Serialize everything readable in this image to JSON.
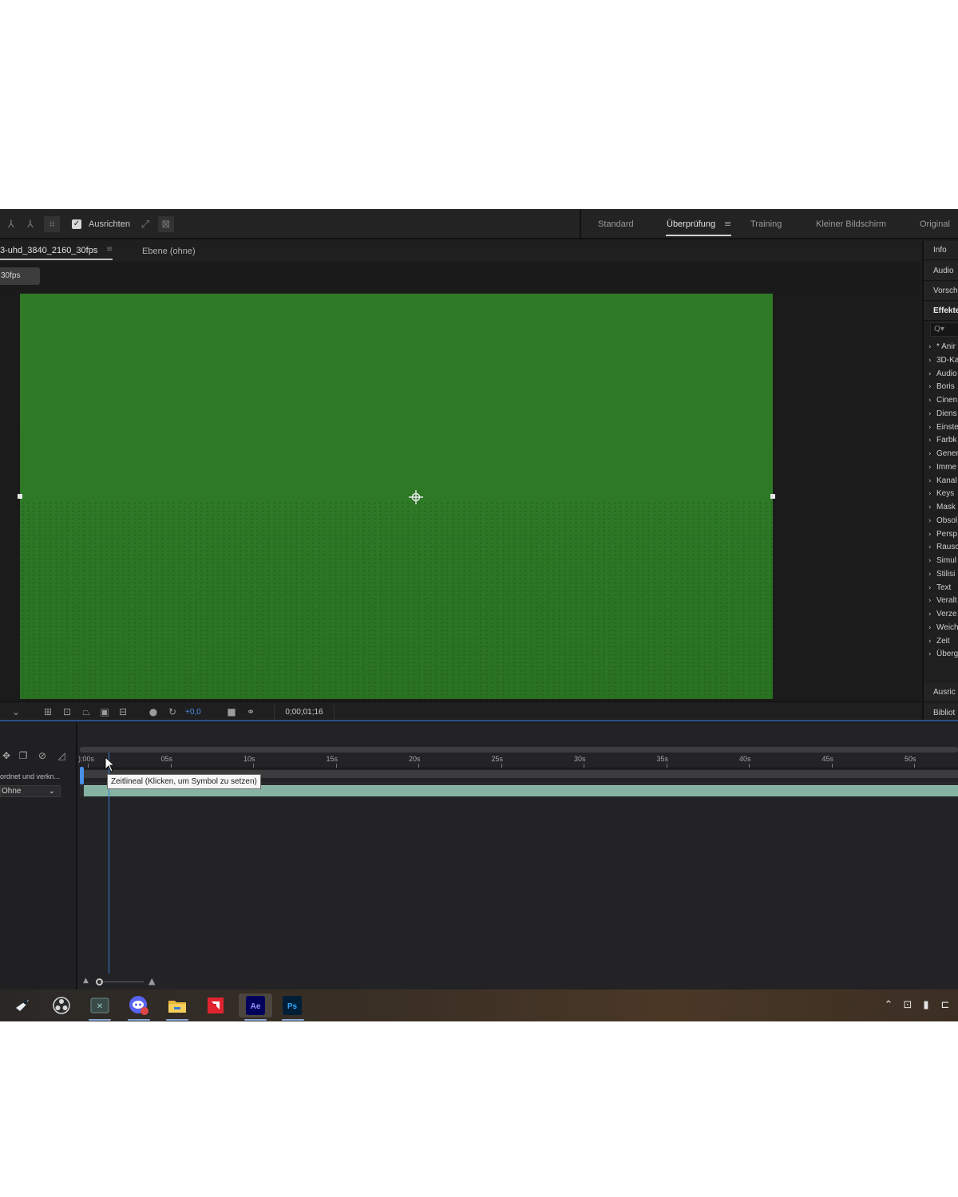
{
  "toolbar": {
    "snap_label": "Ausrichten",
    "workspaces": [
      "Standard",
      "Überprüfung",
      "Training",
      "Kleiner Bildschirm",
      "Original"
    ],
    "active_workspace": "Überprüfung"
  },
  "viewer": {
    "comp_tab": "3-uhd_3840_2160_30fps",
    "layer_tab": "Ebene (ohne)",
    "comp_chip": "30fps",
    "exposure": "+0,0",
    "timecode": "0;00;01;16"
  },
  "right_panel": {
    "headers": [
      "Info",
      "Audio",
      "Vorsch",
      "Effekte"
    ],
    "search_placeholder": "Q▾",
    "effects": [
      "* Anir",
      "3D-Ka",
      "Audio",
      "Boris",
      "Cinen",
      "Diens",
      "Einste",
      "Farbk",
      "Gener",
      "Imme",
      "Kanal",
      "Keys",
      "Mask",
      "Obsol",
      "Persp",
      "Rausc",
      "Simul",
      "Stilisi",
      "Text",
      "Veralt",
      "Verze",
      "Weich",
      "Zeit",
      "Überg"
    ],
    "bottom_headers": [
      "Ausric",
      "Bibliot"
    ]
  },
  "timeline": {
    "layer_label": "ordnet und verkn...",
    "mode_select": "Ohne",
    "ticks": [
      "):00s",
      "05s",
      "10s",
      "15s",
      "20s",
      "25s",
      "30s",
      "35s",
      "40s",
      "45s",
      "50s"
    ],
    "tooltip": "Zeitlineal (Klicken, um Symbol zu setzen)"
  },
  "taskbar": {
    "apps": [
      "steam-icon",
      "obs-icon",
      "excel-icon",
      "discord-icon",
      "file-explorer-icon",
      "amd-icon",
      "after-effects-icon",
      "photoshop-icon"
    ],
    "ae_label": "Ae",
    "ps_label": "Ps"
  },
  "colors": {
    "green_screen": "#2e7a27",
    "accent_blue": "#4a8fe6",
    "clip_color": "#8fbfae"
  }
}
